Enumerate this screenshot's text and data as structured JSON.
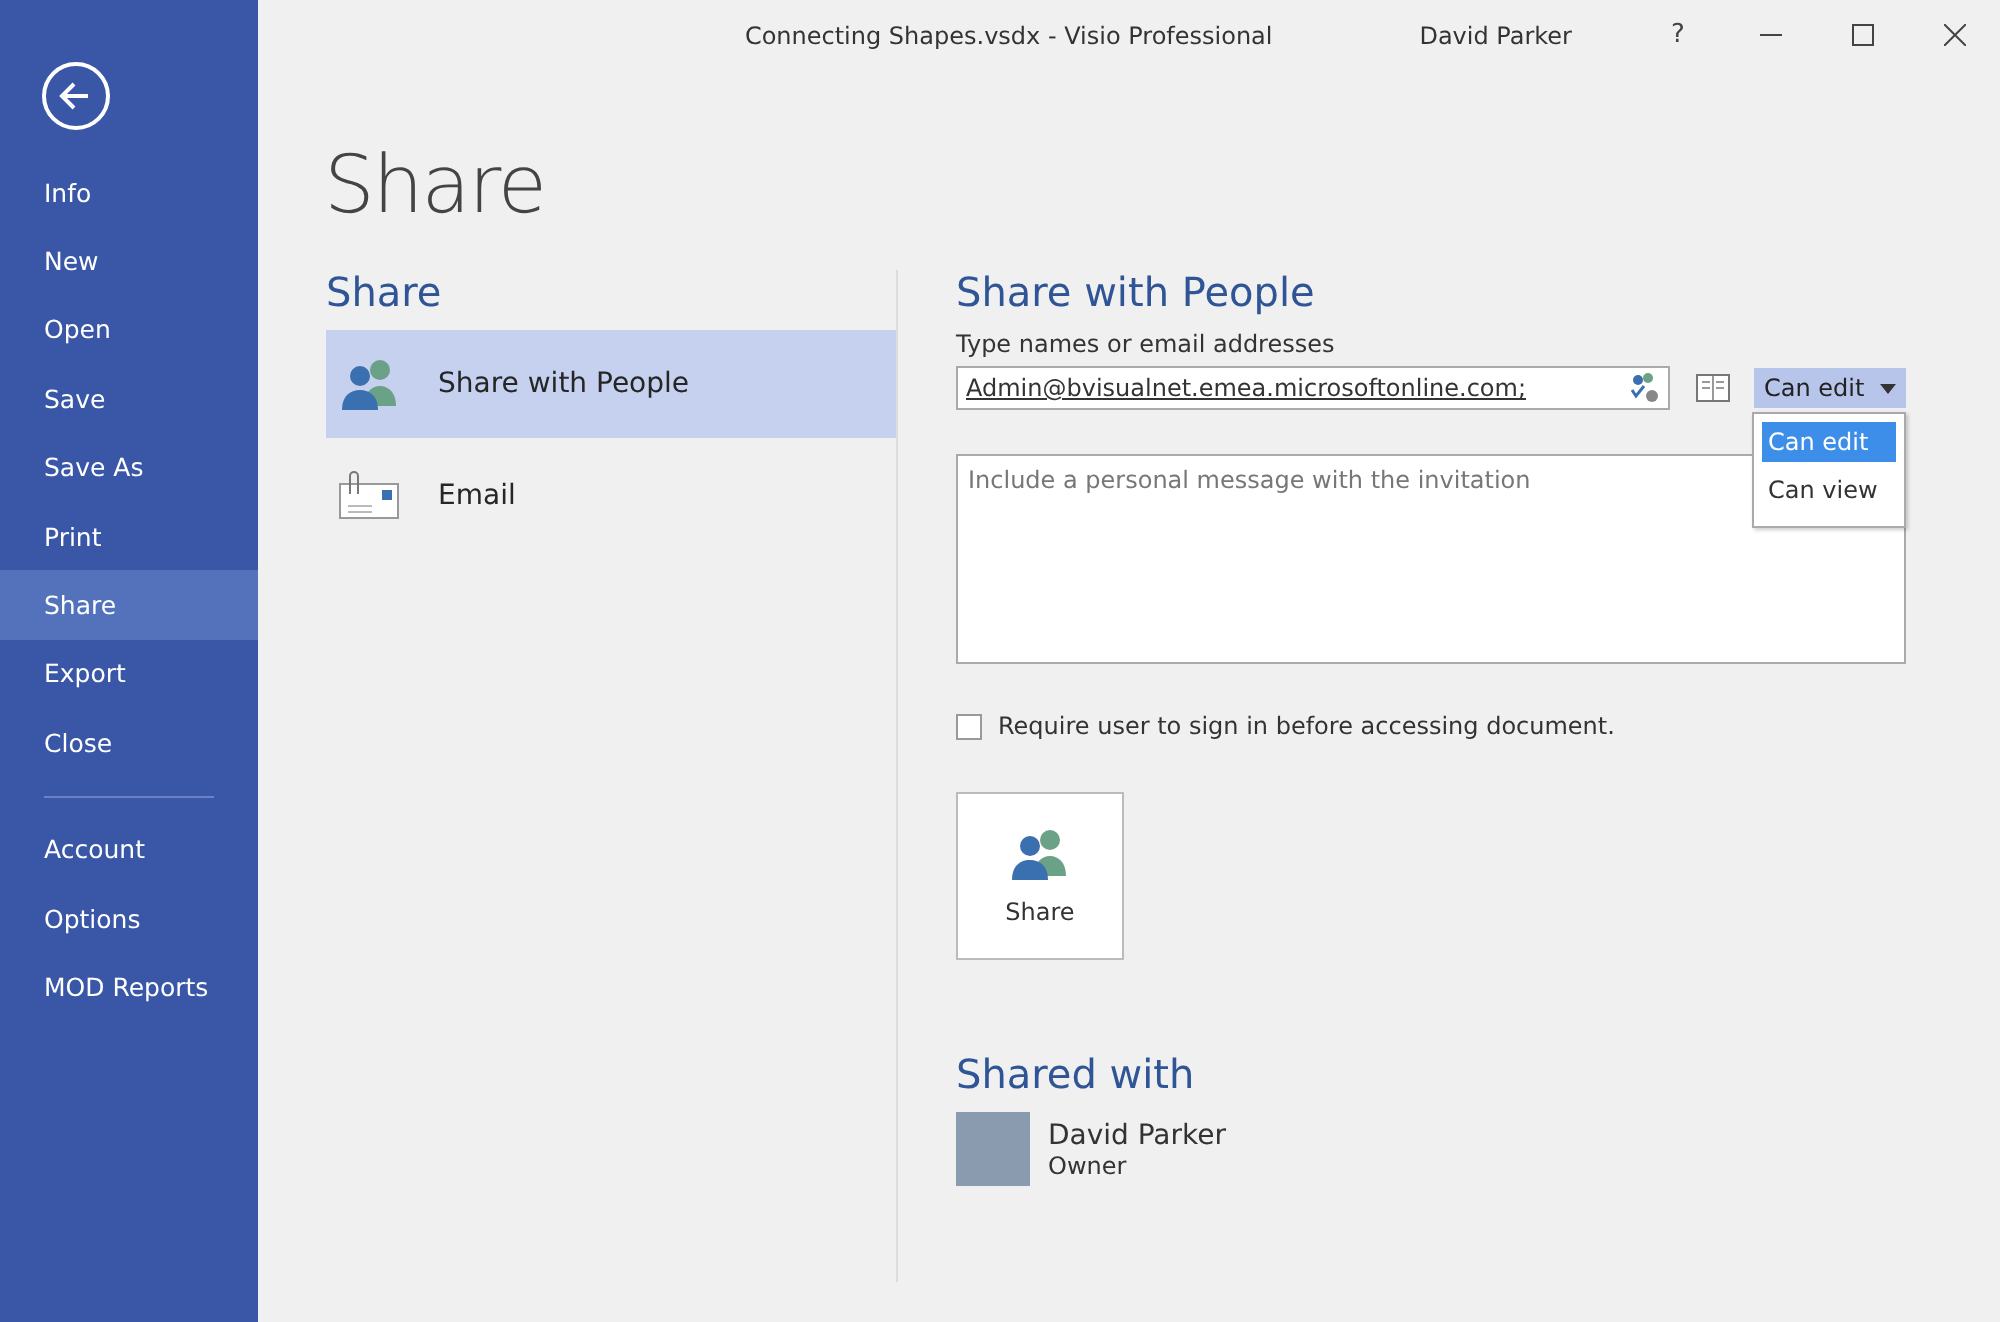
{
  "window": {
    "title": "Connecting Shapes.vsdx - Visio Professional",
    "user": "David Parker",
    "help": "?"
  },
  "sidebar": {
    "items": [
      {
        "label": "Info",
        "selected": false
      },
      {
        "label": "New",
        "selected": false
      },
      {
        "label": "Open",
        "selected": false
      },
      {
        "label": "Save",
        "selected": false
      },
      {
        "label": "Save As",
        "selected": false
      },
      {
        "label": "Print",
        "selected": false
      },
      {
        "label": "Share",
        "selected": true
      },
      {
        "label": "Export",
        "selected": false
      },
      {
        "label": "Close",
        "selected": false
      }
    ],
    "account_items": [
      {
        "label": "Account",
        "selected": false
      },
      {
        "label": "Options",
        "selected": false
      },
      {
        "label": "MOD Reports",
        "selected": false
      }
    ]
  },
  "page_title": "Share",
  "share_options": {
    "heading": "Share",
    "items": [
      {
        "label": "Share with People",
        "kind": "people",
        "selected": true
      },
      {
        "label": "Email",
        "kind": "email",
        "selected": false
      }
    ]
  },
  "share_with_people": {
    "heading": "Share with People",
    "field_label": "Type names or email addresses",
    "recipients": "Admin@bvisualnet.emea.microsoftonline.com;",
    "permission": {
      "value": "Can edit",
      "menu_open": true,
      "options": [
        {
          "label": "Can edit",
          "selected": true
        },
        {
          "label": "Can view",
          "selected": false
        }
      ]
    },
    "message_placeholder": "Include a personal message with the invitation",
    "require_sign_in": {
      "label": "Require user to sign in before accessing document.",
      "checked": false
    },
    "share_button": "Share"
  },
  "shared_with": {
    "heading": "Shared with",
    "people": [
      {
        "name": "David Parker",
        "role": "Owner"
      }
    ]
  }
}
